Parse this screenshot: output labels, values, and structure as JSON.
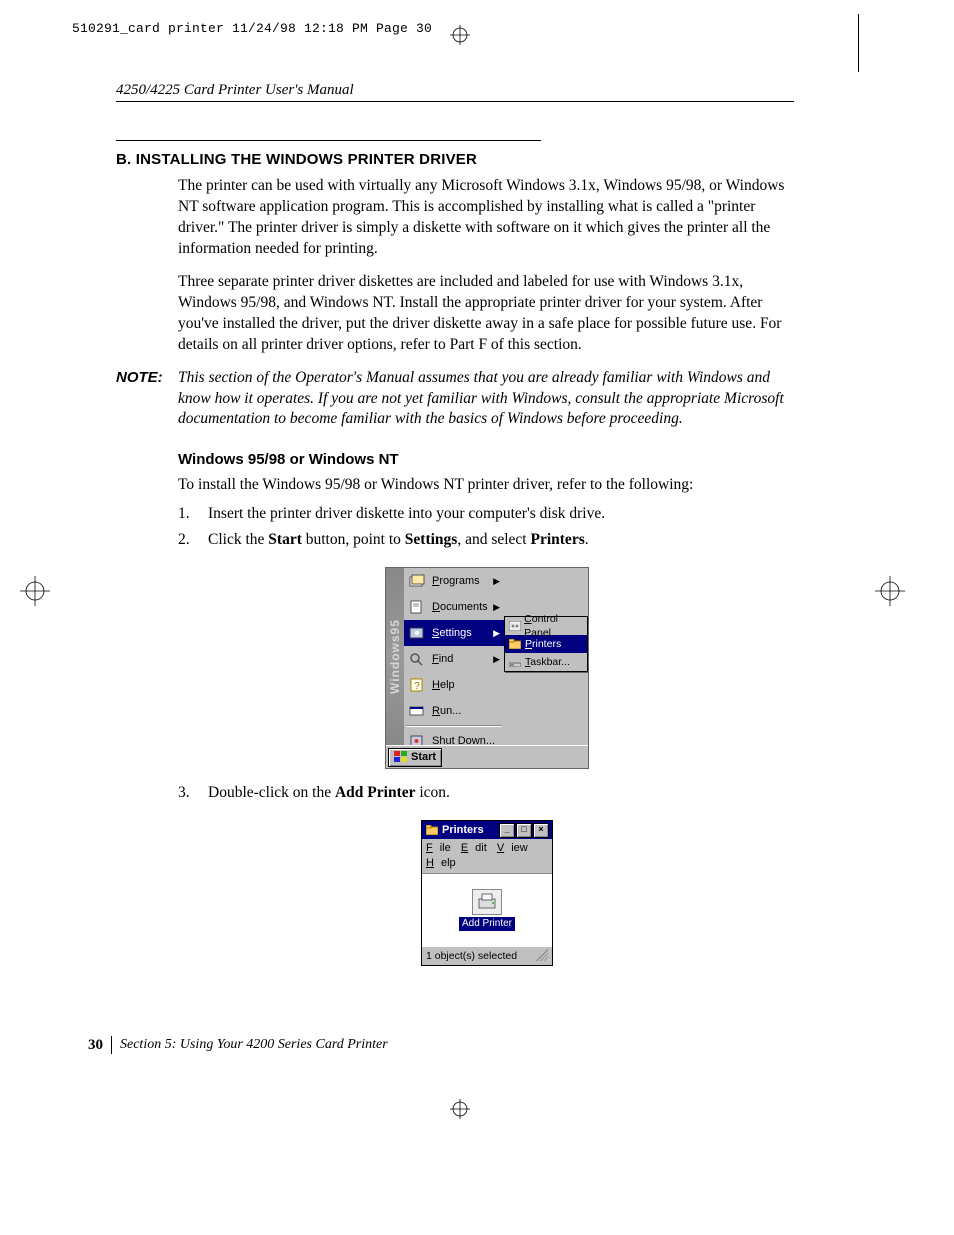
{
  "slug": "510291_card printer  11/24/98 12:18 PM  Page 30",
  "running_head": "4250/4225 Card Printer User's Manual",
  "heading_b": "B. INSTALLING THE WINDOWS PRINTER DRIVER",
  "para1": "The printer can be used with virtually any Microsoft Windows 3.1x, Windows 95/98, or Windows NT software application program. This is accomplished by installing what is called a \"printer driver.\" The printer driver is simply a diskette with software on it which gives the printer all the information needed for printing.",
  "para2": "Three separate printer driver diskettes are included and labeled for use with Windows 3.1x, Windows 95/98, and Windows NT. Install the appropriate printer driver for your system. After you've installed the driver, put the driver diskette away in a safe place for possible future use. For details on all printer driver options, refer to Part F of this section.",
  "note_label": "NOTE:",
  "note_body": "This section of the Operator's Manual assumes that you are already familiar with Windows and know how it operates. If you are not yet familiar with Windows, consult the appropriate Microsoft documentation to become familiar with the basics of Windows before proceeding.",
  "heading_sub": "Windows 95/98 or Windows NT",
  "para_sub": "To install the Windows 95/98 or Windows NT printer driver, refer to the following:",
  "steps": {
    "s1": "Insert the printer driver diskette into your computer's disk drive.",
    "s2_a": "Click the ",
    "s2_b": "Start",
    "s2_c": " button, point to ",
    "s2_d": "Settings",
    "s2_e": ", and select ",
    "s2_f": "Printers",
    "s2_g": ".",
    "s3_a": "Double-click on the ",
    "s3_b": "Add Printer",
    "s3_c": " icon."
  },
  "fig1": {
    "sidebar": "Windows95",
    "items": {
      "programs": "Programs",
      "documents": "Documents",
      "settings": "Settings",
      "find": "Find",
      "help": "Help",
      "run": "Run...",
      "shutdown": "Shut Down..."
    },
    "submenu": {
      "control_panel": "Control Panel",
      "printers": "Printers",
      "taskbar": "Taskbar..."
    },
    "start": "Start"
  },
  "fig2": {
    "title": "Printers",
    "menus": {
      "file": "File",
      "edit": "Edit",
      "view": "View",
      "help": "Help"
    },
    "icon_label": "Add Printer",
    "status": "1 object(s) selected"
  },
  "folio": {
    "page": "30",
    "section": "Section 5:  Using Your 4200 Series Card Printer"
  }
}
